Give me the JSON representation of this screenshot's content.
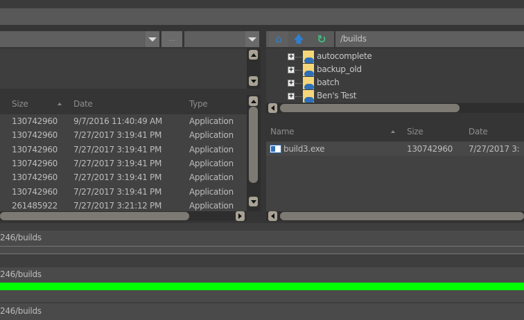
{
  "left": {
    "columns": {
      "size": "Size",
      "date": "Date",
      "type": "Type"
    },
    "browse_label": "...",
    "rows": [
      {
        "size": "130742960",
        "date": "9/7/2016 11:40:49 AM",
        "type": "Application"
      },
      {
        "size": "130742960",
        "date": "7/27/2017 3:19:41 PM",
        "type": "Application"
      },
      {
        "size": "130742960",
        "date": "7/27/2017 3:19:41 PM",
        "type": "Application"
      },
      {
        "size": "130742960",
        "date": "7/27/2017 3:19:41 PM",
        "type": "Application"
      },
      {
        "size": "130742960",
        "date": "7/27/2017 3:19:41 PM",
        "type": "Application"
      },
      {
        "size": "130742960",
        "date": "7/27/2017 3:19:41 PM",
        "type": "Application"
      },
      {
        "size": "261485922",
        "date": "7/27/2017 3:21:12 PM",
        "type": "Application"
      }
    ]
  },
  "right": {
    "path": "/builds",
    "tree": [
      {
        "label": "autocomplete"
      },
      {
        "label": "backup_old"
      },
      {
        "label": "batch"
      },
      {
        "label": "Ben's Test"
      }
    ],
    "columns": {
      "name": "Name",
      "size": "Size",
      "date": "Date"
    },
    "files": [
      {
        "name": "build3.exe",
        "size": "130742960",
        "date": "7/27/2017 3:"
      }
    ]
  },
  "transfers": [
    {
      "path": "246/builds"
    },
    {
      "path": "246/builds",
      "progress": 100
    },
    {
      "path": "246/builds"
    }
  ],
  "colors": {
    "progress": "#00ff00",
    "home": "#2f7fd0",
    "refresh": "#3fbf7f"
  }
}
